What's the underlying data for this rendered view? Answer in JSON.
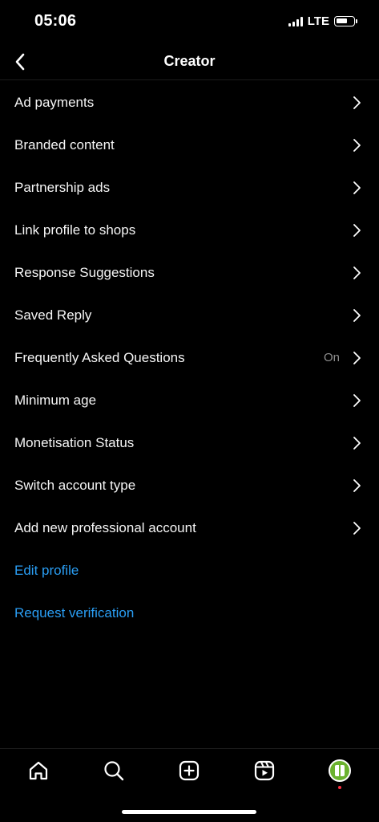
{
  "status_bar": {
    "time": "05:06",
    "network": "LTE",
    "signal_icon": "signal-icon",
    "battery_icon": "battery-icon"
  },
  "header": {
    "title": "Creator",
    "back_icon": "chevron-left-icon"
  },
  "menu": {
    "items": [
      {
        "label": "Ad payments",
        "value": ""
      },
      {
        "label": "Branded content",
        "value": ""
      },
      {
        "label": "Partnership ads",
        "value": ""
      },
      {
        "label": "Link profile to shops",
        "value": ""
      },
      {
        "label": "Response Suggestions",
        "value": ""
      },
      {
        "label": "Saved Reply",
        "value": ""
      },
      {
        "label": "Frequently Asked Questions",
        "value": "On"
      },
      {
        "label": "Minimum age",
        "value": ""
      },
      {
        "label": "Monetisation Status",
        "value": ""
      },
      {
        "label": "Switch account type",
        "value": ""
      },
      {
        "label": "Add new professional account",
        "value": ""
      }
    ],
    "links": [
      {
        "label": "Edit profile"
      },
      {
        "label": "Request verification"
      }
    ]
  },
  "tab_bar": {
    "tabs": [
      "home-icon",
      "search-icon",
      "create-icon",
      "reels-icon",
      "profile-avatar"
    ]
  },
  "colors": {
    "background": "#000000",
    "link": "#2a9ef4",
    "secondary_text": "#8e8e8e",
    "notification": "#ff3040",
    "avatar": "#6bb22e"
  }
}
